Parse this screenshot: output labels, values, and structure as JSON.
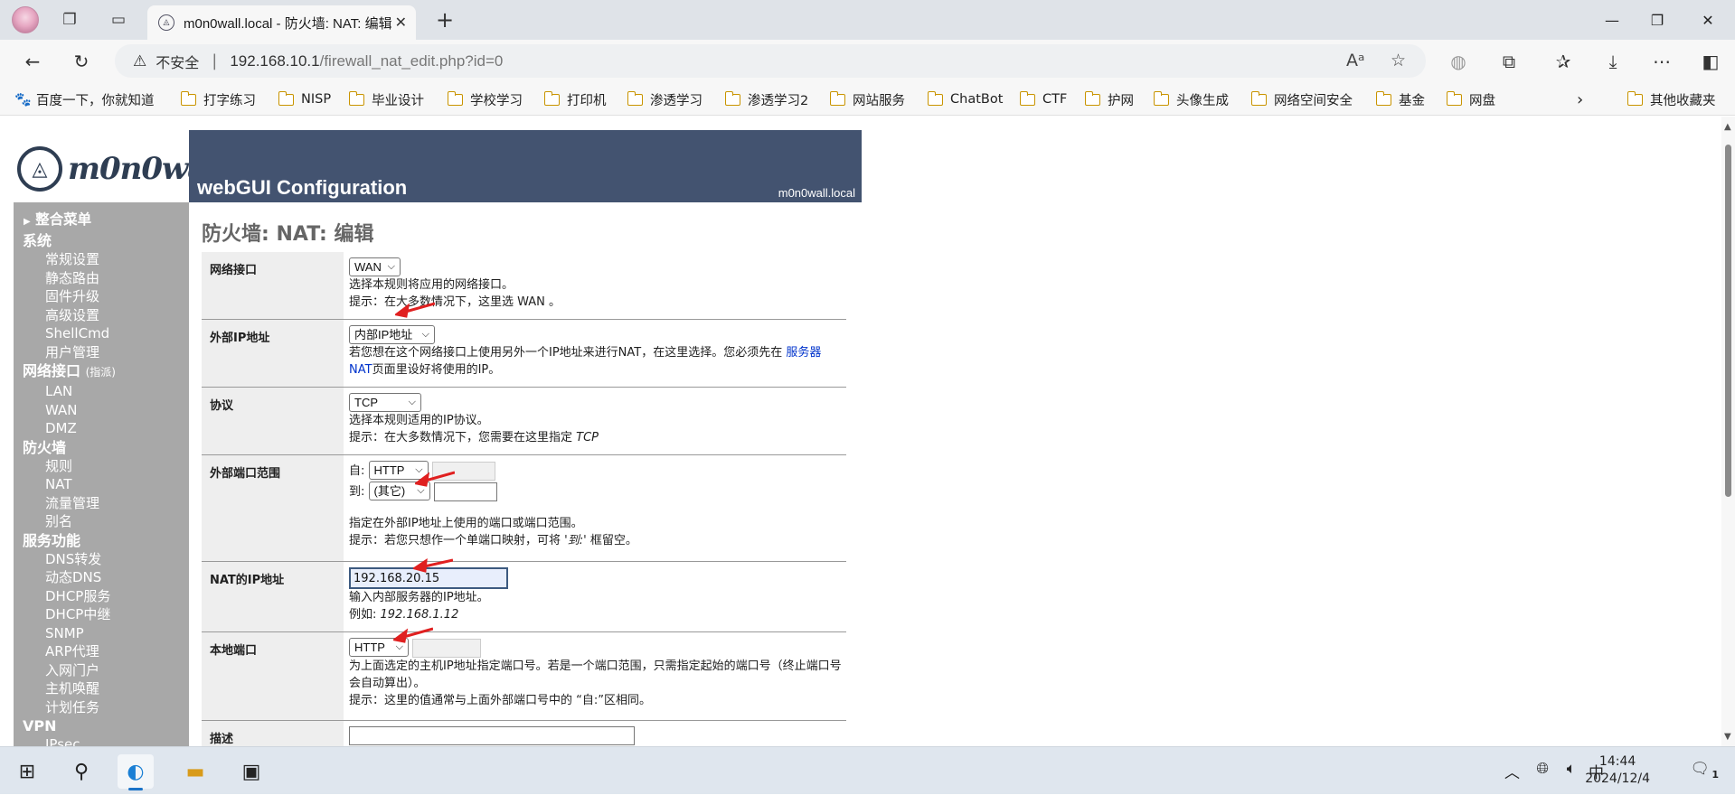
{
  "browser": {
    "tab_title": "m0n0wall.local - 防火墙: NAT: 编辑",
    "address": {
      "security_label": "不安全",
      "url_host": "192.168.10.1",
      "url_path": "/firewall_nat_edit.php?id=0"
    },
    "bookmarks": [
      {
        "label": "百度一下，你就知道",
        "icon": "baidu-paw-icon"
      },
      {
        "label": "打字练习",
        "icon": "folder-icon"
      },
      {
        "label": "NISP",
        "icon": "folder-icon"
      },
      {
        "label": "毕业设计",
        "icon": "folder-icon"
      },
      {
        "label": "学校学习",
        "icon": "folder-icon"
      },
      {
        "label": "打印机",
        "icon": "folder-icon"
      },
      {
        "label": "渗透学习",
        "icon": "folder-icon"
      },
      {
        "label": "渗透学习2",
        "icon": "folder-icon"
      },
      {
        "label": "网站服务",
        "icon": "folder-icon"
      },
      {
        "label": "ChatBot",
        "icon": "folder-icon"
      },
      {
        "label": "CTF",
        "icon": "folder-icon"
      },
      {
        "label": "护网",
        "icon": "folder-icon"
      },
      {
        "label": "头像生成",
        "icon": "folder-icon"
      },
      {
        "label": "网络空间安全",
        "icon": "folder-icon"
      },
      {
        "label": "基金",
        "icon": "folder-icon"
      },
      {
        "label": "网盘",
        "icon": "folder-icon"
      }
    ],
    "other_bookmarks": "其他收藏夹"
  },
  "app": {
    "logo_text": "m0n0wall",
    "header_title": "webGUI Configuration",
    "hostname": "m0n0wall.local",
    "page_title": "防火墙: NAT: 编辑"
  },
  "menu": {
    "collapse_label": "整合菜单",
    "sections": [
      {
        "title": "系统",
        "items": [
          "常规设置",
          "静态路由",
          "固件升级",
          "高级设置",
          "ShellCmd",
          "用户管理"
        ]
      },
      {
        "title": "网络接口",
        "suffix": "(指派)",
        "items": [
          "LAN",
          "WAN",
          "DMZ"
        ]
      },
      {
        "title": "防火墙",
        "items": [
          "规则",
          "NAT",
          "流量管理",
          "别名"
        ]
      },
      {
        "title": "服务功能",
        "items": [
          "DNS转发",
          "动态DNS",
          "DHCP服务",
          "DHCP中继",
          "SNMP",
          "ARP代理",
          "入网门户",
          "主机唤醒",
          "计划任务"
        ]
      },
      {
        "title": "VPN",
        "items": [
          "IPsec"
        ]
      }
    ]
  },
  "form": {
    "interface": {
      "label": "网络接口",
      "value": "WAN",
      "help1": "选择本规则将应用的网络接口。",
      "help2": "提示：在大多数情况下，这里选 WAN 。"
    },
    "external_ip": {
      "label": "外部IP地址",
      "value": "内部IP地址",
      "help_a": "若您想在这个网络接口上使用另外一个IP地址来进行NAT，在这里选择。您必须先在 ",
      "help_link": "服务器 NAT",
      "help_b": "页面里设好将使用的IP。"
    },
    "protocol": {
      "label": "协议",
      "value": "TCP",
      "help1": "选择本规则适用的IP协议。",
      "help2_a": "提示：在大多数情况下，您需要在这里指定 ",
      "help2_b": "TCP"
    },
    "ext_port_range": {
      "label": "外部端口范围",
      "from_label": "自:",
      "from_value": "HTTP",
      "to_label": "到:",
      "to_value": "(其它)",
      "help1": "指定在外部IP地址上使用的端口或端口范围。",
      "help2_a": "提示：若您只想作一个单端口映射，可将 '",
      "help2_b": "到:",
      "help2_c": "' 框留空。"
    },
    "nat_ip": {
      "label": "NAT的IP地址",
      "value": "192.168.20.15",
      "help1": "输入内部服务器的IP地址。",
      "help2_a": "例如: ",
      "help2_b": "192.168.1.12"
    },
    "local_port": {
      "label": "本地端口",
      "value": "HTTP",
      "help1": "为上面选定的主机IP地址指定端口号。若是一个端口范围，只需指定起始的端口号（终止端口号会自动算出）。",
      "help2": "提示：这里的值通常与上面外部端口号中的 “自:”区相同。"
    },
    "description": {
      "label": "描述",
      "value": ""
    }
  },
  "taskbar": {
    "ime": "中",
    "time": "14:44",
    "date": "2024/12/4",
    "notifications": "1"
  },
  "colors": {
    "header_bg": "#435370",
    "menu_bg": "#a8a8a8",
    "label_bg": "#eeeeee",
    "link": "#0033cc",
    "annotation_arrow": "#e02020"
  }
}
